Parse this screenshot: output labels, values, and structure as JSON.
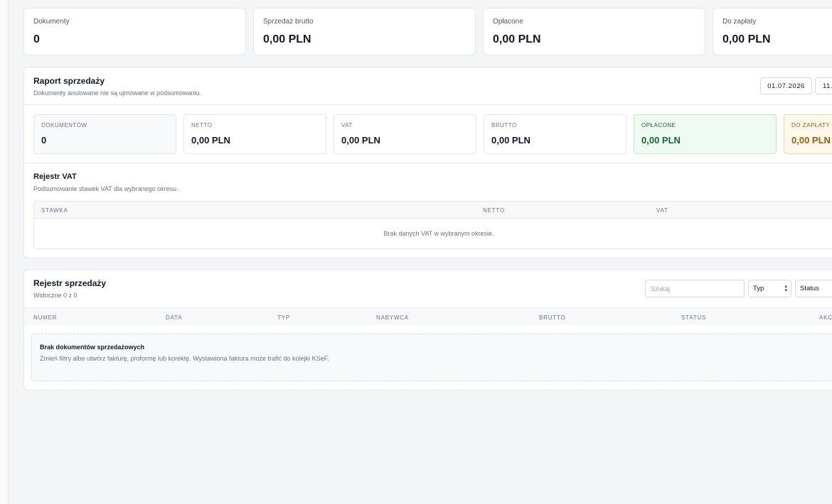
{
  "summary_cards": [
    {
      "label": "Dokumenty",
      "value": "0"
    },
    {
      "label": "Sprzedaż brutto",
      "value": "0,00 PLN"
    },
    {
      "label": "Opłacone",
      "value": "0,00 PLN"
    },
    {
      "label": "Do zapłaty",
      "value": "0,00 PLN"
    }
  ],
  "report": {
    "title": "Raport sprzedaży",
    "subtitle": "Dokumenty anulowane nie są ujmowane w podsumowaniu.",
    "date_from": "01.07.2026",
    "date_to": "11.",
    "metrics": [
      {
        "label": "DOKUMENTÓW",
        "value": "0"
      },
      {
        "label": "NETTO",
        "value": "0,00 PLN"
      },
      {
        "label": "VAT",
        "value": "0,00 PLN"
      },
      {
        "label": "BRUTTO",
        "value": "0,00 PLN"
      },
      {
        "label": "OPŁACONE",
        "value": "0,00 PLN"
      },
      {
        "label": "DO ZAPŁATY",
        "value": "0,00 PLN"
      }
    ]
  },
  "vat_register": {
    "title": "Rejestr VAT",
    "subtitle": "Podsumowanie stawek VAT dla wybranego okresu.",
    "columns": [
      "STAWKA",
      "NETTO",
      "VAT"
    ],
    "empty": "Brak danych VAT w wybranym okresie."
  },
  "sales_register": {
    "title": "Rejestr sprzedaży",
    "count": "Widoczne 0 z 0",
    "search_placeholder": "Szukaj",
    "type_filter": "Typ",
    "status_filter": "Status",
    "columns": [
      "NUMER",
      "DATA",
      "TYP",
      "NABYWCA",
      "BRUTTO",
      "STATUS",
      "AKCJE"
    ],
    "empty_title": "Brak dokumentów sprzedażowych",
    "empty_desc": "Zmień filtry albo utwórz fakturę, proformę lub korektę. Wystawiona faktura może trafić do kolejki KSeF."
  }
}
